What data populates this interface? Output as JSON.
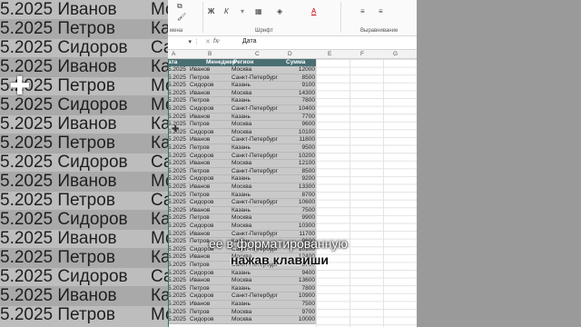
{
  "background": {
    "rows": [
      {
        "date": "5.2025",
        "manager": "Иванов",
        "region": "Мо"
      },
      {
        "date": "5.2025",
        "manager": "Петров",
        "region": "Ка"
      },
      {
        "date": "5.2025",
        "manager": "Сидоров",
        "region": "Са"
      },
      {
        "date": "5.2025",
        "manager": "Иванов",
        "region": "Ка"
      },
      {
        "date": "5.2025",
        "manager": "Петров",
        "region": "Мо"
      },
      {
        "date": "5.2025",
        "manager": "Сидоров",
        "region": "Мо"
      },
      {
        "date": "5.2025",
        "manager": "Иванов",
        "region": "Ка"
      },
      {
        "date": "5.2025",
        "manager": "Петров",
        "region": "Ка"
      },
      {
        "date": "5.2025",
        "manager": "Сидоров",
        "region": "Са"
      },
      {
        "date": "5.2025",
        "manager": "Иванов",
        "region": "Мо"
      },
      {
        "date": "5.2025",
        "manager": "Петров",
        "region": "Са"
      },
      {
        "date": "5.2025",
        "manager": "Сидоров",
        "region": "Ка"
      },
      {
        "date": "5.2025",
        "manager": "Иванов",
        "region": "Мо"
      },
      {
        "date": "5.2025",
        "manager": "Петров",
        "region": "Ка"
      },
      {
        "date": "5.2025",
        "manager": "Сидоров",
        "region": "Са"
      },
      {
        "date": "5.2025",
        "manager": "Иванов",
        "region": "Ка"
      },
      {
        "date": "5.2025",
        "manager": "Петров",
        "region": "Мо"
      }
    ]
  },
  "ribbon": {
    "clipboard_label": "мена",
    "font_label": "Шрифт",
    "align_label": "Выравнивание",
    "bold": "Ж",
    "italic": "К",
    "font_color": "A"
  },
  "formula_bar": {
    "fx": "fx",
    "value": "Дата"
  },
  "columns": [
    "A",
    "B",
    "C",
    "D",
    "E",
    "F",
    "G"
  ],
  "table": {
    "headers": [
      "ата",
      "Менеджер",
      "Регион",
      "Сумма"
    ],
    "rows": [
      [
        "5.2025",
        "Иванов",
        "Москва",
        "12000"
      ],
      [
        "5.2025",
        "Петров",
        "Санкт-Петербург",
        "8500"
      ],
      [
        "5.2025",
        "Сидоров",
        "Казань",
        "9100"
      ],
      [
        "5.2025",
        "Иванов",
        "Москва",
        "14300"
      ],
      [
        "5.2025",
        "Петров",
        "Казань",
        "7800"
      ],
      [
        "5.2025",
        "Сидоров",
        "Санкт-Петербург",
        "10400"
      ],
      [
        "5.2025",
        "Иванов",
        "Казань",
        "7700"
      ],
      [
        "5.2025",
        "Петров",
        "Москва",
        "9600"
      ],
      [
        "5.2025",
        "Сидоров",
        "Москва",
        "10100"
      ],
      [
        "5.2025",
        "Иванов",
        "Санкт-Петербург",
        "11800"
      ],
      [
        "5.2025",
        "Петров",
        "Казань",
        "9500"
      ],
      [
        "5.2025",
        "Сидоров",
        "Санкт-Петербург",
        "10200"
      ],
      [
        "5.2025",
        "Иванов",
        "Москва",
        "12100"
      ],
      [
        "5.2025",
        "Петров",
        "Санкт-Петербург",
        "8500"
      ],
      [
        "5.2025",
        "Сидоров",
        "Казань",
        "9200"
      ],
      [
        "5.2025",
        "Иванов",
        "Москва",
        "13300"
      ],
      [
        "5.2025",
        "Петров",
        "Казань",
        "8700"
      ],
      [
        "5.2025",
        "Сидоров",
        "Санкт-Петербург",
        "10600"
      ],
      [
        "5.2025",
        "Иванов",
        "Казань",
        "7500"
      ],
      [
        "5.2025",
        "Петров",
        "Москва",
        "9900"
      ],
      [
        "5.2025",
        "Сидоров",
        "Москва",
        "10300"
      ],
      [
        "5.2025",
        "Иванов",
        "Санкт-Петербург",
        "11700"
      ],
      [
        "5.2025",
        "Петров",
        "Казань",
        "9600"
      ],
      [
        "5.2025",
        "Сидоров",
        "Санкт-Петербург",
        "10100"
      ],
      [
        "5.2025",
        "Иванов",
        "Москва",
        "12400"
      ],
      [
        "5.2025",
        "Петров",
        "Санкт-Петербург",
        "8700"
      ],
      [
        "5.2025",
        "Сидоров",
        "Казань",
        "9400"
      ],
      [
        "5.2025",
        "Иванов",
        "Москва",
        "13600"
      ],
      [
        "5.2025",
        "Петров",
        "Казань",
        "7800"
      ],
      [
        "5.2025",
        "Сидоров",
        "Санкт-Петербург",
        "10900"
      ],
      [
        "5.2025",
        "Иванов",
        "Казань",
        "7500"
      ],
      [
        "5.2025",
        "Петров",
        "Москва",
        "9700"
      ],
      [
        "5.2025",
        "Сидоров",
        "Москва",
        "10000"
      ]
    ]
  },
  "captions": {
    "line1": "ее в форматированную",
    "line2": "нажав клавиши"
  },
  "colors": {
    "table_header": "#4a6f73",
    "selection": "#c9c9c9"
  }
}
